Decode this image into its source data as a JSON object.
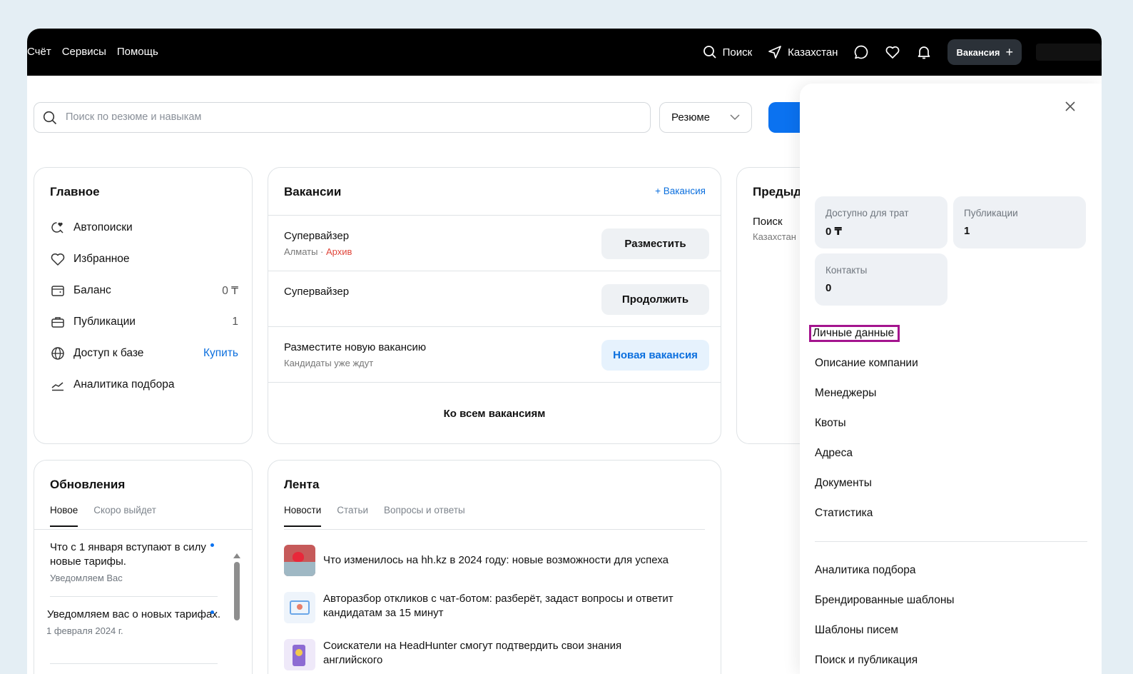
{
  "topbar": {
    "left_items": [
      "Счёт",
      "Сервисы",
      "Помощь"
    ],
    "search": "Поиск",
    "region": "Казахстан",
    "vacancy_button": "Вакансия"
  },
  "search": {
    "placeholder": "Поиск по резюме и навыкам",
    "type_select": "Резюме"
  },
  "main_card": {
    "title": "Главное",
    "items": [
      {
        "label": "Автопоиски",
        "icon": "autosearch-icon",
        "value": ""
      },
      {
        "label": "Избранное",
        "icon": "heart-icon",
        "value": ""
      },
      {
        "label": "Баланс",
        "icon": "wallet-icon",
        "value": "0 ₸"
      },
      {
        "label": "Публикации",
        "icon": "briefcase-icon",
        "value": "1"
      },
      {
        "label": "Доступ к базе",
        "icon": "globe-icon",
        "action": "Купить"
      },
      {
        "label": "Аналитика подбора",
        "icon": "chart-icon",
        "value": ""
      }
    ]
  },
  "vacancies": {
    "title": "Вакансии",
    "add_label": "+ Вакансия",
    "rows": [
      {
        "title": "Супервайзер",
        "city": "Алматы",
        "status": "Архив",
        "button": "Разместить"
      },
      {
        "title": "Супервайзер",
        "button": "Продолжить"
      },
      {
        "title": "Разместите новую вакансию",
        "sub": "Кандидаты уже ждут",
        "button": "Новая вакансия"
      }
    ],
    "all_link": "Ко всем вакансиям"
  },
  "pred": {
    "title": "Предыд",
    "line1": "Поиск",
    "line2": "Казахстан"
  },
  "updates": {
    "title": "Обновления",
    "tabs": [
      "Новое",
      "Скоро выйдет"
    ],
    "items": [
      {
        "title": "Что с 1 января вступают в силу новые тарифы.",
        "sub": "Уведомляем Вас"
      },
      {
        "title": "Уведомляем вас о новых тарифах.",
        "sub": "1 февраля 2024 г."
      }
    ]
  },
  "feed": {
    "title": "Лента",
    "tabs": [
      "Новости",
      "Статьи",
      "Вопросы и ответы"
    ],
    "news": [
      "Что изменилось на hh.kz в 2024 году: новые возможности для успеха",
      "Авторазбор откликов с чат-ботом: разберёт, задаст вопросы и ответит кандидатам за 15 минут",
      "Соискатели на HeadHunter смогут подтвердить свои знания английского"
    ]
  },
  "panel": {
    "stats": [
      {
        "label": "Доступно для трат",
        "value": "0 ₸"
      },
      {
        "label": "Публикации",
        "value": "1"
      },
      {
        "label": "Контакты",
        "value": "0"
      }
    ],
    "links_top": [
      "Личные данные",
      "Описание компании",
      "Менеджеры",
      "Квоты",
      "Адреса",
      "Документы",
      "Статистика"
    ],
    "links_bottom": [
      "Аналитика подбора",
      "Брендированные шаблоны",
      "Шаблоны писем",
      "Поиск и публикация"
    ]
  }
}
